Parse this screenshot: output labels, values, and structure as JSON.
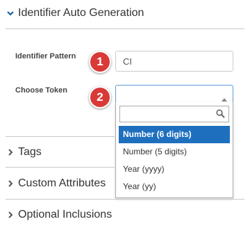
{
  "sections": {
    "identifier_auto_generation": {
      "label": "Identifier Auto Generation",
      "expanded": true
    },
    "tags": {
      "label": "Tags",
      "expanded": false
    },
    "custom_attributes": {
      "label": "Custom Attributes",
      "expanded": false
    },
    "optional_inclusions": {
      "label": "Optional Inclusions",
      "expanded": false
    }
  },
  "form": {
    "identifier_pattern": {
      "label": "Identifier Pattern",
      "value": "CI"
    },
    "choose_token": {
      "label": "Choose Token",
      "value": ""
    }
  },
  "dropdown": {
    "search_value": "",
    "options": [
      {
        "label": "Number (6 digits)",
        "selected": true
      },
      {
        "label": "Number (5 digits)",
        "selected": false
      },
      {
        "label": "Year (yyyy)",
        "selected": false
      },
      {
        "label": "Year (yy)",
        "selected": false
      }
    ]
  },
  "callouts": [
    "1",
    "2"
  ],
  "colors": {
    "accent": "#1f6fbf",
    "callout": "#d93a37",
    "chevron_expanded": "#1a5fa0"
  },
  "icons": {
    "expanded": "chevron-down-icon",
    "collapsed": "chevron-right-icon",
    "select": "caret-up-icon",
    "search": "search-icon"
  }
}
